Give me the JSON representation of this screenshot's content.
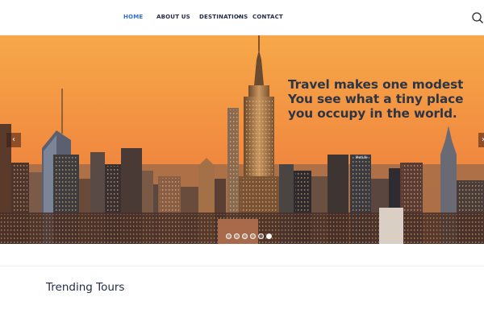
{
  "nav": {
    "items": [
      {
        "label": "HOME",
        "active": true
      },
      {
        "label": "ABOUT US",
        "active": false
      },
      {
        "label": "DESTINATIONS",
        "active": false,
        "has_dropdown": true
      },
      {
        "label": "CONTACT",
        "active": false
      }
    ],
    "search_icon": "search-icon",
    "dropdown_icon": "chevron-down-icon",
    "active_color": "#2f6fd6",
    "text_color": "#1f2a44"
  },
  "hero": {
    "caption_lines": [
      "Travel makes one modest",
      "You see what a tiny place",
      "you occupy in the world."
    ],
    "sign_text": "MetLife",
    "prev_icon": "chevron-left-icon",
    "next_icon": "chevron-right-icon",
    "slide_count": 6,
    "active_slide": 6,
    "sky_colors": [
      "#f7a24a",
      "#f28a3e",
      "#e8783a"
    ]
  },
  "sections": {
    "trending_title": "Trending Tours"
  }
}
